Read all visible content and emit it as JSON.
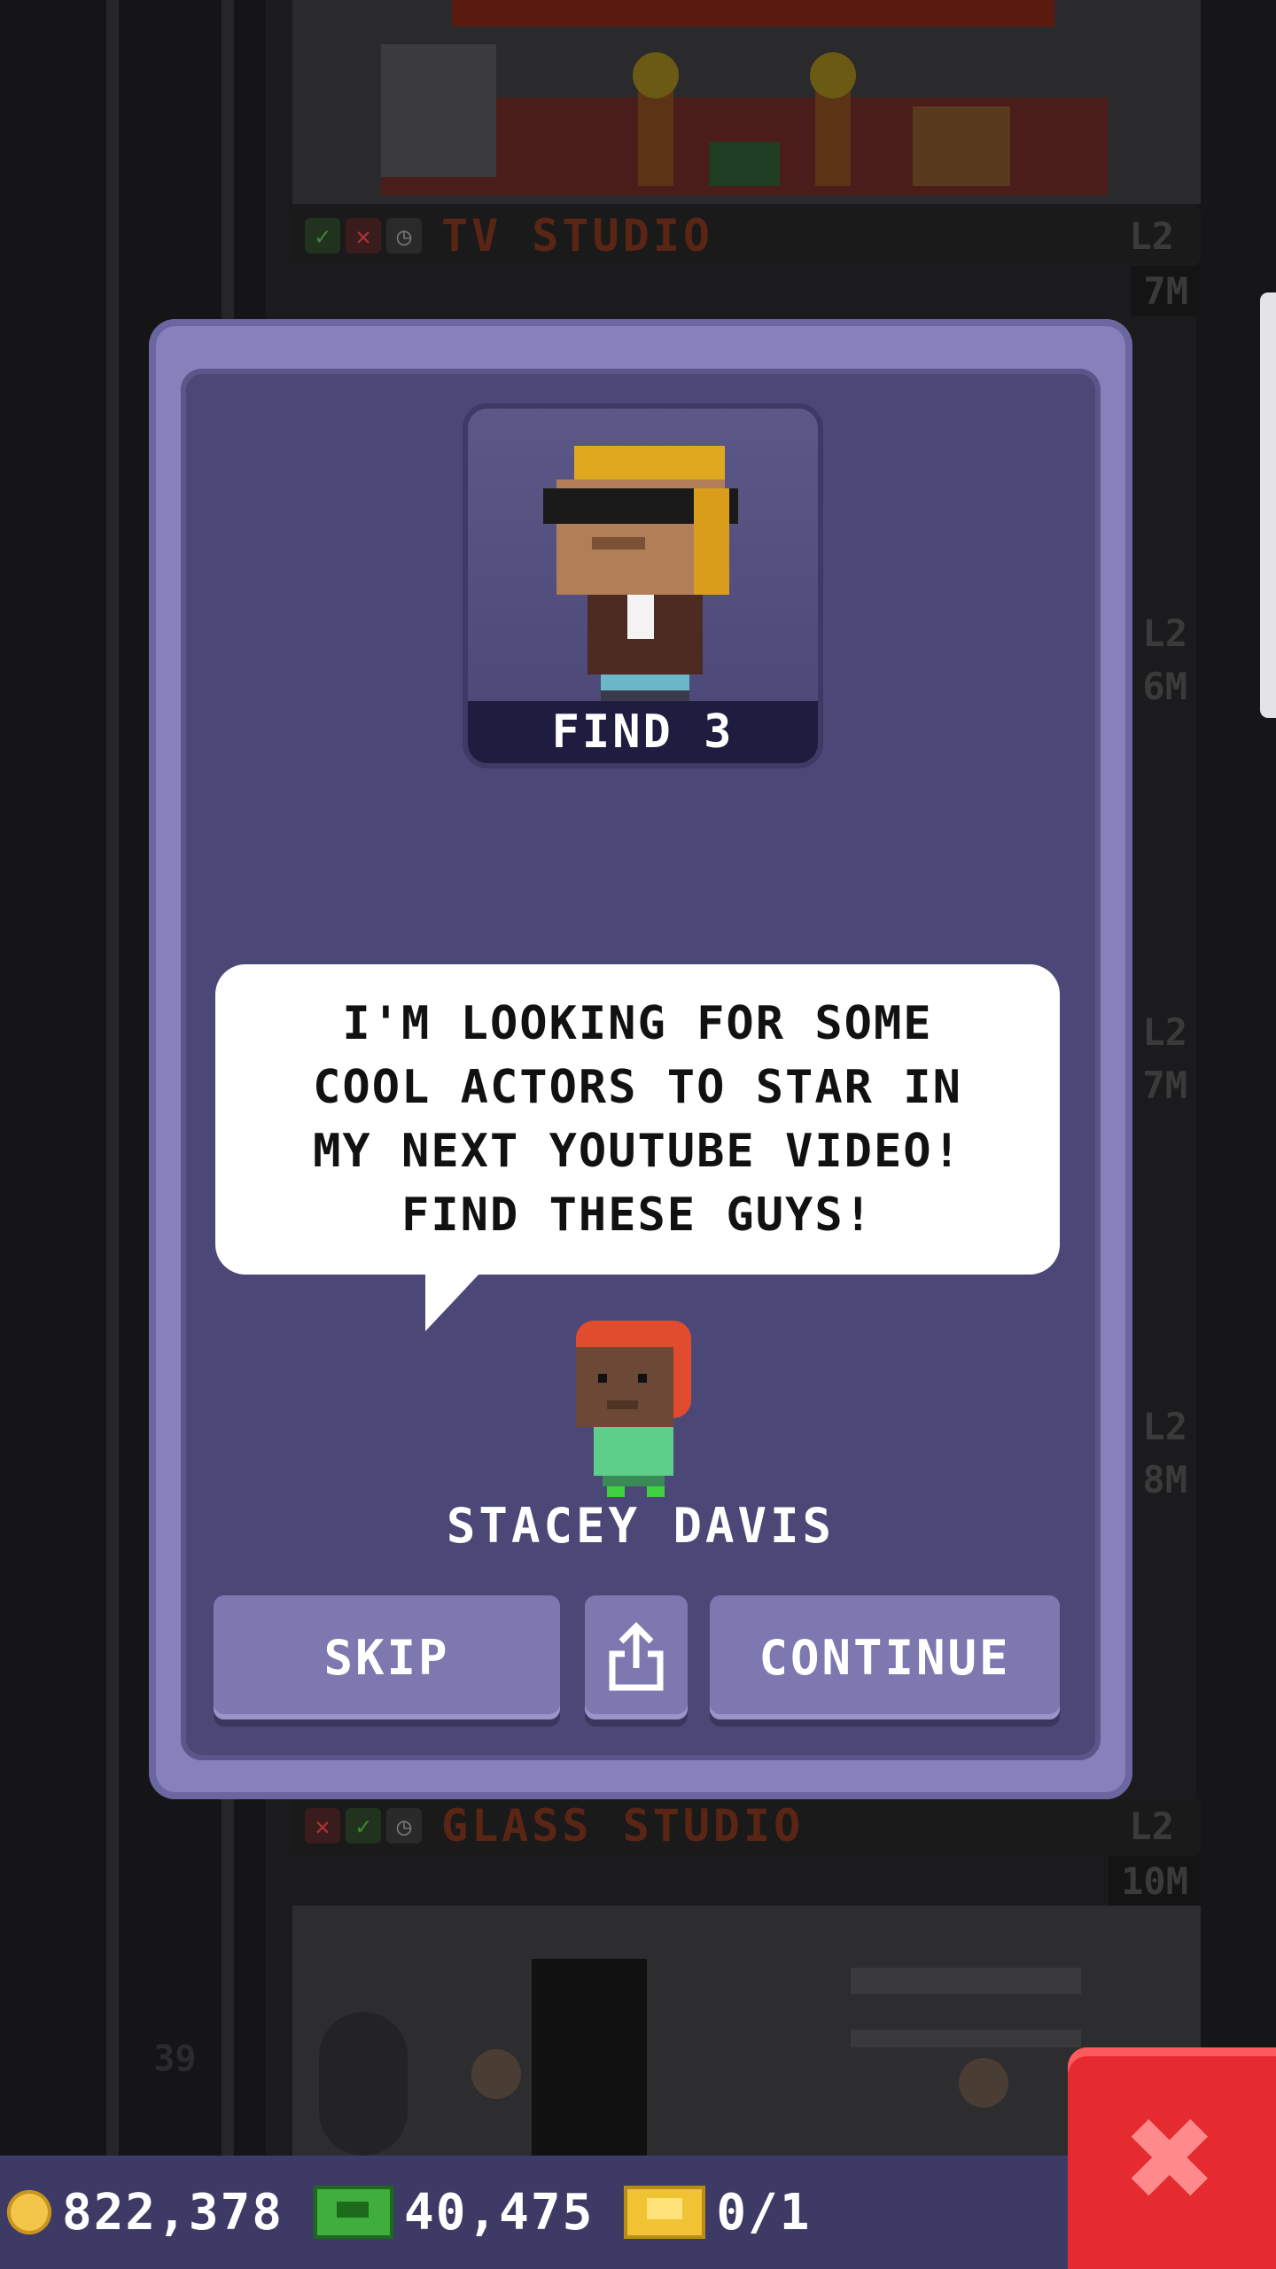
{
  "background": {
    "floors_top": [
      {
        "name": "TV STUDIO",
        "level": "L2",
        "income": "7M",
        "status": [
          "ok",
          "no",
          "clock"
        ]
      }
    ],
    "side_levels": [
      "L2",
      "6M",
      "L2",
      "7M",
      "L2",
      "8M"
    ],
    "floors_bottom": [
      {
        "name": "GLASS STUDIO",
        "level": "L2",
        "income": "10M",
        "status": [
          "no",
          "ok",
          "clock"
        ]
      }
    ],
    "floor_number": "39"
  },
  "dialog": {
    "portrait_label": "FIND 3",
    "speech": "I'M LOOKING FOR SOME\nCOOL ACTORS TO STAR IN\nMY NEXT YOUTUBE VIDEO!\nFIND THESE GUYS!",
    "speaker_name": "STACEY DAVIS",
    "buttons": {
      "skip": "SKIP",
      "continue": "CONTINUE"
    }
  },
  "bottom_bar": {
    "coins": "822,378",
    "bux": "40,475",
    "tickets": "0/1"
  },
  "colors": {
    "dialog_frame": "#8680bb",
    "dialog_inner": "#4b4878",
    "close_button": "#e52b2f"
  },
  "icons": {
    "share": "share-icon",
    "close": "close-icon",
    "coin": "coin-icon",
    "bux": "bux-icon",
    "ticket": "ticket-icon"
  }
}
